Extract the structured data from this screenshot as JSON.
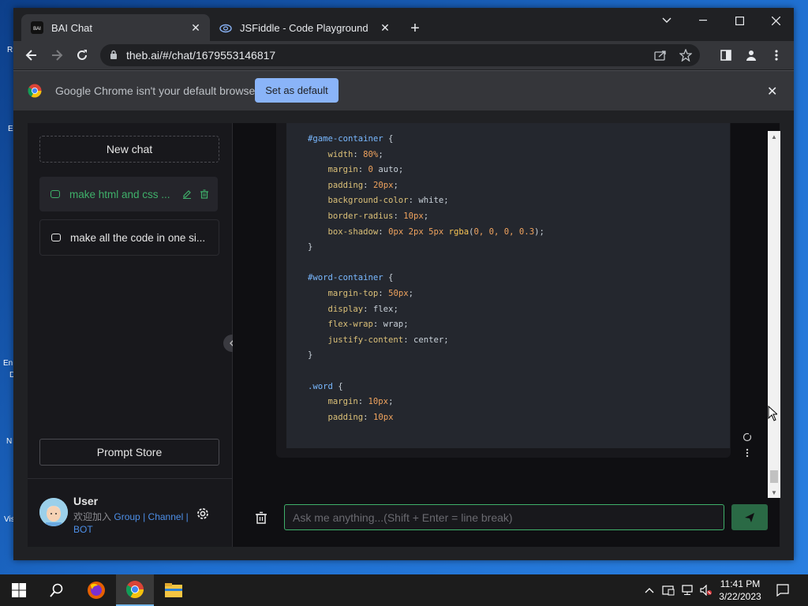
{
  "desktop": {
    "fragments": [
      "R",
      "E",
      "En",
      "D",
      "N",
      "Vis"
    ]
  },
  "browser": {
    "tabs": [
      {
        "title": "BAI Chat",
        "favicon": "bai-icon",
        "active": true
      },
      {
        "title": "JSFiddle - Code Playground",
        "favicon": "jsfiddle-icon",
        "active": false
      }
    ],
    "url": "theb.ai/#/chat/1679553146817",
    "infobar": {
      "message": "Google Chrome isn't your default browser",
      "button": "Set as default"
    }
  },
  "sidebar": {
    "new_chat": "New chat",
    "chats": [
      {
        "label": "make html and css ...",
        "active": true
      },
      {
        "label": "make all the code in one si...",
        "active": false
      }
    ],
    "prompt_store": "Prompt Store",
    "user": {
      "name": "User",
      "join_text": "欢迎加入",
      "links": [
        "Group",
        "Channel",
        "BOT"
      ],
      "separator": "|"
    }
  },
  "code_lines": [
    [
      {
        "t": "#game-container",
        "c": "sel"
      },
      {
        "t": " {",
        "c": "val"
      }
    ],
    [
      {
        "t": "    width",
        "c": "prop"
      },
      {
        "t": ": ",
        "c": "val"
      },
      {
        "t": "80%",
        "c": "num"
      },
      {
        "t": ";",
        "c": "val"
      }
    ],
    [
      {
        "t": "    margin",
        "c": "prop"
      },
      {
        "t": ": ",
        "c": "val"
      },
      {
        "t": "0",
        "c": "num"
      },
      {
        "t": " auto;",
        "c": "val"
      }
    ],
    [
      {
        "t": "    padding",
        "c": "prop"
      },
      {
        "t": ": ",
        "c": "val"
      },
      {
        "t": "20px",
        "c": "num"
      },
      {
        "t": ";",
        "c": "val"
      }
    ],
    [
      {
        "t": "    background-color",
        "c": "prop"
      },
      {
        "t": ": white;",
        "c": "val"
      }
    ],
    [
      {
        "t": "    border-radius",
        "c": "prop"
      },
      {
        "t": ": ",
        "c": "val"
      },
      {
        "t": "10px",
        "c": "num"
      },
      {
        "t": ";",
        "c": "val"
      }
    ],
    [
      {
        "t": "    box-shadow",
        "c": "prop"
      },
      {
        "t": ": ",
        "c": "val"
      },
      {
        "t": "0px 2px 5px",
        "c": "num"
      },
      {
        "t": " ",
        "c": "val"
      },
      {
        "t": "rgba",
        "c": "fn"
      },
      {
        "t": "(",
        "c": "val"
      },
      {
        "t": "0, 0, 0, 0.3",
        "c": "num"
      },
      {
        "t": ");",
        "c": "val"
      }
    ],
    [
      {
        "t": "}",
        "c": "val"
      }
    ],
    [
      {
        "t": "",
        "c": "val"
      }
    ],
    [
      {
        "t": "#word-container",
        "c": "sel"
      },
      {
        "t": " {",
        "c": "val"
      }
    ],
    [
      {
        "t": "    margin-top",
        "c": "prop"
      },
      {
        "t": ": ",
        "c": "val"
      },
      {
        "t": "50px",
        "c": "num"
      },
      {
        "t": ";",
        "c": "val"
      }
    ],
    [
      {
        "t": "    display",
        "c": "prop"
      },
      {
        "t": ": flex;",
        "c": "val"
      }
    ],
    [
      {
        "t": "    flex-wrap",
        "c": "prop"
      },
      {
        "t": ": wrap;",
        "c": "val"
      }
    ],
    [
      {
        "t": "    justify-content",
        "c": "prop"
      },
      {
        "t": ": center;",
        "c": "val"
      }
    ],
    [
      {
        "t": "}",
        "c": "val"
      }
    ],
    [
      {
        "t": "",
        "c": "val"
      }
    ],
    [
      {
        "t": ".word",
        "c": "sel"
      },
      {
        "t": " {",
        "c": "val"
      }
    ],
    [
      {
        "t": "    margin",
        "c": "prop"
      },
      {
        "t": ": ",
        "c": "val"
      },
      {
        "t": "10px",
        "c": "num"
      },
      {
        "t": ";",
        "c": "val"
      }
    ],
    [
      {
        "t": "    padding",
        "c": "prop"
      },
      {
        "t": ": ",
        "c": "val"
      },
      {
        "t": "10px",
        "c": "num"
      }
    ]
  ],
  "input": {
    "placeholder": "Ask me anything...(Shift + Enter = line break)",
    "value": ""
  },
  "taskbar": {
    "time": "11:41 PM",
    "date": "3/22/2023"
  },
  "colors": {
    "accent": "#3fb06a",
    "link": "#4d8fe8",
    "infobar_button": "#8ab4f8"
  }
}
